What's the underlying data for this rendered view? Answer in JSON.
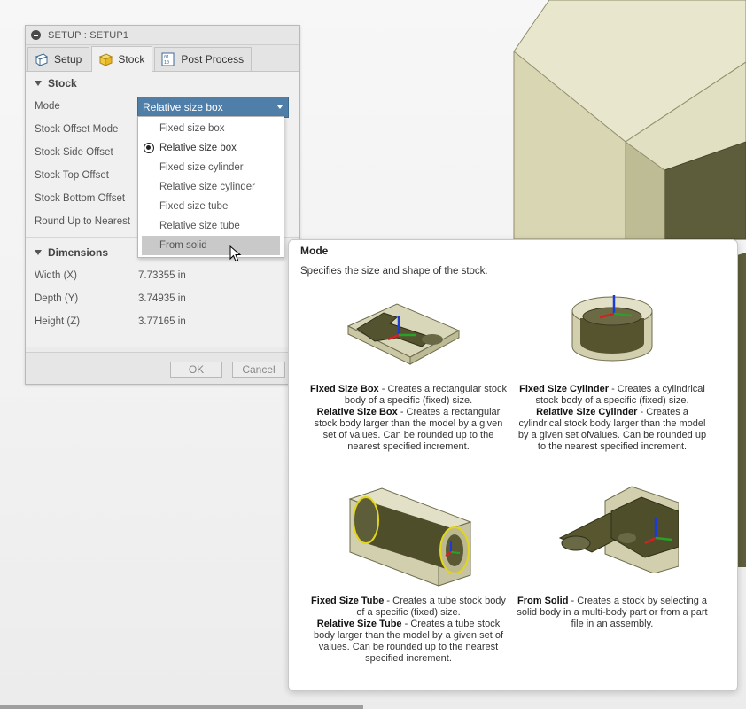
{
  "dialog": {
    "title": "SETUP : SETUP1",
    "tabs": [
      {
        "label": "Setup",
        "icon": "setup-icon"
      },
      {
        "label": "Stock",
        "icon": "stock-icon"
      },
      {
        "label": "Post Process",
        "icon": "post-process-icon"
      }
    ],
    "stock_section": "Stock",
    "mode_label": "Mode",
    "mode_value": "Relative size box",
    "rows": [
      {
        "label": "Stock Offset Mode"
      },
      {
        "label": "Stock Side Offset"
      },
      {
        "label": "Stock Top Offset"
      },
      {
        "label": "Stock Bottom Offset"
      },
      {
        "label": "Round Up to Nearest"
      }
    ],
    "dimensions_section": "Dimensions",
    "dimensions": [
      {
        "label": "Width (X)",
        "value": "7.73355 in"
      },
      {
        "label": "Depth (Y)",
        "value": "3.74935 in"
      },
      {
        "label": "Height (Z)",
        "value": "3.77165 in"
      }
    ],
    "ok_label": "OK",
    "cancel_label": "Cancel"
  },
  "dropdown": {
    "options": [
      "Fixed size box",
      "Relative size box",
      "Fixed size cylinder",
      "Relative size cylinder",
      "Fixed size tube",
      "Relative size tube",
      "From solid"
    ],
    "selected": "Relative size box",
    "hovered": "From solid"
  },
  "tooltip": {
    "title": "Mode",
    "description": "Specifies the size and shape of the stock.",
    "items": [
      {
        "line1_bold": "Fixed Size Box",
        "line1_rest": " - Creates a rectangular stock body of a specific (fixed) size.",
        "line2_bold": "Relative Size Box",
        "line2_rest": " - Creates a rectangular stock body larger than the model by a given set of values. Can be rounded up to the nearest specified increment."
      },
      {
        "line1_bold": "Fixed Size Cylinder",
        "line1_rest": " - Creates a cylindrical stock body of a specific (fixed) size.",
        "line2_bold": "Relative Size Cylinder",
        "line2_rest": " - Creates a cylindrical stock body larger than the model by a given set ofvalues. Can be rounded up to the nearest specified increment."
      },
      {
        "line1_bold": "Fixed Size Tube",
        "line1_rest": " - Creates a tube stock body of a specific (fixed) size.",
        "line2_bold": "Relative Size Tube",
        "line2_rest": " - Creates a tube stock body larger than the model by a given set of values. Can be rounded up to the nearest specified increment."
      },
      {
        "line1_bold": "From Solid",
        "line1_rest": " - Creates a stock by selecting a solid body in a multi-body part or from a part file in an assembly.",
        "line2_bold": "",
        "line2_rest": ""
      }
    ]
  },
  "colors": {
    "select_blue": "#4f7ea8",
    "model_face": "#e4e2c6",
    "model_side": "#d3d1ad",
    "model_dark": "#595836"
  }
}
